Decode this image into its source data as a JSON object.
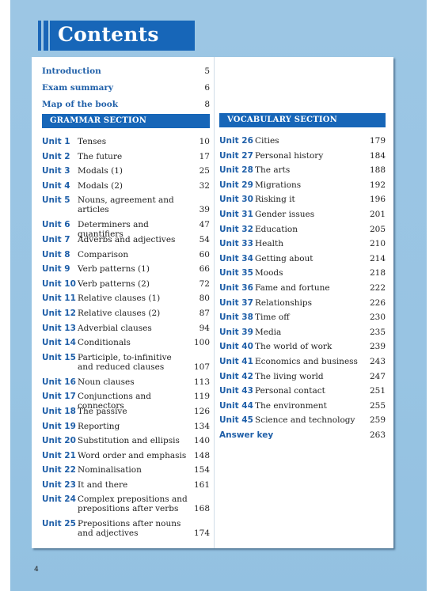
{
  "header": {
    "title": "Contents"
  },
  "front_matter": [
    {
      "label": "Introduction",
      "page": "5"
    },
    {
      "label": "Exam summary",
      "page": "6"
    },
    {
      "label": "Map of the book",
      "page": "8"
    }
  ],
  "grammar": {
    "heading": "GRAMMAR SECTION",
    "units": [
      {
        "unit": "Unit 1",
        "title": "Tenses",
        "page": "10"
      },
      {
        "unit": "Unit 2",
        "title": "The future",
        "page": "17"
      },
      {
        "unit": "Unit 3",
        "title": "Modals (1)",
        "page": "25"
      },
      {
        "unit": "Unit 4",
        "title": "Modals (2)",
        "page": "32"
      },
      {
        "unit": "Unit 5",
        "title": "Nouns, agreement and articles",
        "page": "39"
      },
      {
        "unit": "Unit 6",
        "title": "Determiners and quantifiers",
        "page": "47"
      },
      {
        "unit": "Unit 7",
        "title": "Adverbs and adjectives",
        "page": "54"
      },
      {
        "unit": "Unit 8",
        "title": "Comparison",
        "page": "60"
      },
      {
        "unit": "Unit 9",
        "title": "Verb patterns (1)",
        "page": "66"
      },
      {
        "unit": "Unit 10",
        "title": "Verb patterns (2)",
        "page": "72"
      },
      {
        "unit": "Unit 11",
        "title": "Relative clauses (1)",
        "page": "80"
      },
      {
        "unit": "Unit 12",
        "title": "Relative clauses (2)",
        "page": "87"
      },
      {
        "unit": "Unit 13",
        "title": "Adverbial clauses",
        "page": "94"
      },
      {
        "unit": "Unit 14",
        "title": "Conditionals",
        "page": "100"
      },
      {
        "unit": "Unit 15",
        "title": "Participle, to-infinitive and reduced clauses",
        "page": "107"
      },
      {
        "unit": "Unit 16",
        "title": "Noun clauses",
        "page": "113"
      },
      {
        "unit": "Unit 17",
        "title": "Conjunctions and connectors",
        "page": "119"
      },
      {
        "unit": "Unit 18",
        "title": "The passive",
        "page": "126"
      },
      {
        "unit": "Unit 19",
        "title": "Reporting",
        "page": "134"
      },
      {
        "unit": "Unit 20",
        "title": "Substitution and ellipsis",
        "page": "140"
      },
      {
        "unit": "Unit 21",
        "title": "Word order and emphasis",
        "page": "148"
      },
      {
        "unit": "Unit 22",
        "title": "Nominalisation",
        "page": "154"
      },
      {
        "unit": "Unit 23",
        "title": "It and there",
        "page": "161"
      },
      {
        "unit": "Unit 24",
        "title": "Complex prepositions and prepositions after verbs",
        "page": "168"
      },
      {
        "unit": "Unit 25",
        "title": "Prepositions after nouns and adjectives",
        "page": "174"
      }
    ]
  },
  "vocabulary": {
    "heading": "VOCABULARY SECTION",
    "units": [
      {
        "unit": "Unit 26",
        "title": "Cities",
        "page": "179"
      },
      {
        "unit": "Unit 27",
        "title": "Personal history",
        "page": "184"
      },
      {
        "unit": "Unit 28",
        "title": "The arts",
        "page": "188"
      },
      {
        "unit": "Unit 29",
        "title": "Migrations",
        "page": "192"
      },
      {
        "unit": "Unit 30",
        "title": "Risking it",
        "page": "196"
      },
      {
        "unit": "Unit 31",
        "title": "Gender issues",
        "page": "201"
      },
      {
        "unit": "Unit 32",
        "title": "Education",
        "page": "205"
      },
      {
        "unit": "Unit 33",
        "title": "Health",
        "page": "210"
      },
      {
        "unit": "Unit 34",
        "title": "Getting about",
        "page": "214"
      },
      {
        "unit": "Unit 35",
        "title": "Moods",
        "page": "218"
      },
      {
        "unit": "Unit 36",
        "title": "Fame and fortune",
        "page": "222"
      },
      {
        "unit": "Unit 37",
        "title": "Relationships",
        "page": "226"
      },
      {
        "unit": "Unit 38",
        "title": "Time off",
        "page": "230"
      },
      {
        "unit": "Unit 39",
        "title": "Media",
        "page": "235"
      },
      {
        "unit": "Unit 40",
        "title": "The world of work",
        "page": "239"
      },
      {
        "unit": "Unit 41",
        "title": "Economics and business",
        "page": "243"
      },
      {
        "unit": "Unit 42",
        "title": "The living world",
        "page": "247"
      },
      {
        "unit": "Unit 43",
        "title": "Personal contact",
        "page": "251"
      },
      {
        "unit": "Unit 44",
        "title": "The environment",
        "page": "255"
      },
      {
        "unit": "Unit 45",
        "title": "Science and technology",
        "page": "259"
      }
    ],
    "answer_key": {
      "label": "Answer key",
      "page": "263"
    }
  },
  "footer": {
    "page_number": "4"
  }
}
